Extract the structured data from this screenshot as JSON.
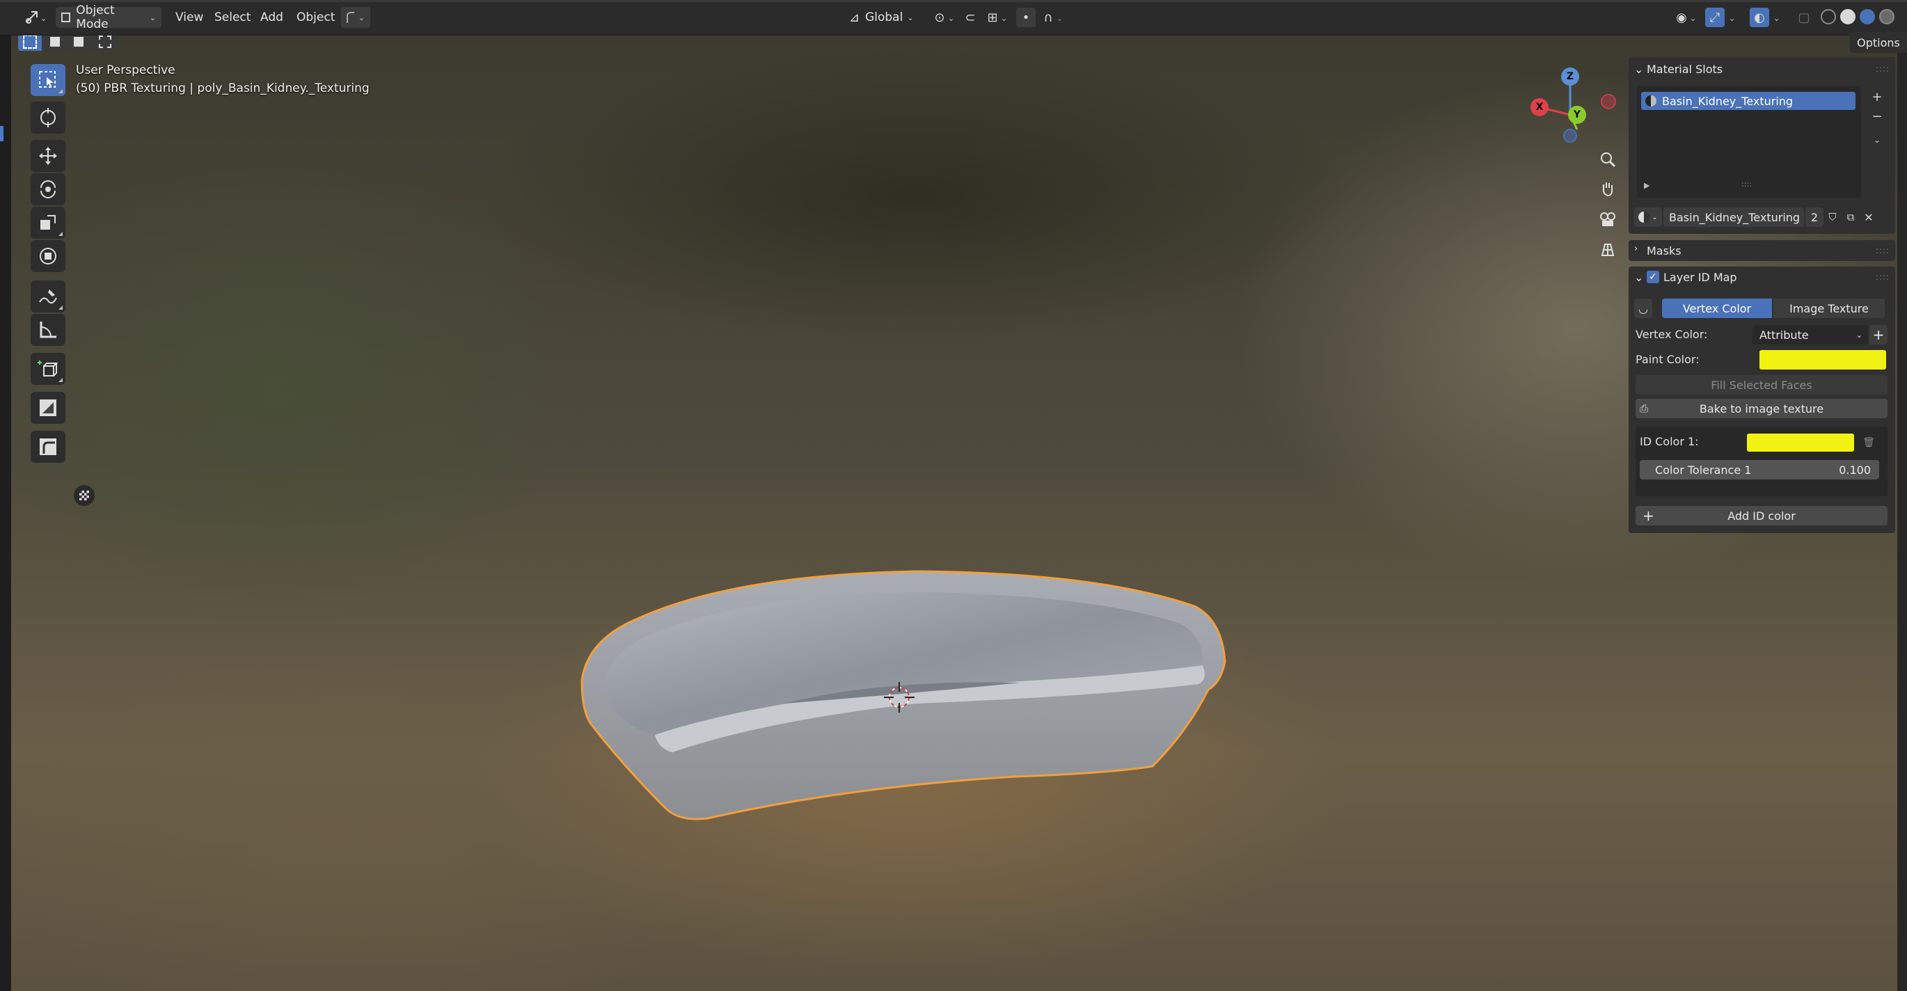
{
  "header": {
    "mode": "Object Mode",
    "menus": [
      "View",
      "Select",
      "Add",
      "Object"
    ],
    "transform_orientation": "Global",
    "options_label": "Options"
  },
  "viewport": {
    "perspective": "User Perspective",
    "object_info": "(50) PBR Texturing | poly_Basin_Kidney._Texturing",
    "gizmo": {
      "z": "Z",
      "x": "X",
      "y": "Y"
    }
  },
  "toolbar": {
    "tools": [
      "select-box",
      "cursor",
      "move",
      "rotate",
      "scale",
      "transform",
      "annotate",
      "measure",
      "add-cube",
      "texture-tool",
      "curve-tool"
    ]
  },
  "material_slots": {
    "title": "Material Slots",
    "slots": [
      "Basin_Kidney_Texturing"
    ],
    "material_name": "Basin_Kidney_Texturing",
    "user_count": "2"
  },
  "masks": {
    "title": "Masks"
  },
  "layer_id_map": {
    "title": "Layer ID Map",
    "tab_vertex": "Vertex Color",
    "tab_image": "Image Texture",
    "vertex_color_label": "Vertex Color:",
    "vertex_color_value": "Attribute",
    "paint_color_label": "Paint Color:",
    "fill_faces": "Fill Selected Faces",
    "bake": "Bake to image texture",
    "id_color_label": "ID Color 1:",
    "tolerance_label": "Color Tolerance 1",
    "tolerance_value": "0.100",
    "add_id": "Add ID color"
  },
  "colors": {
    "accent": "#4a72b8",
    "paint": "#f2f212",
    "outline": "#f0a040"
  }
}
